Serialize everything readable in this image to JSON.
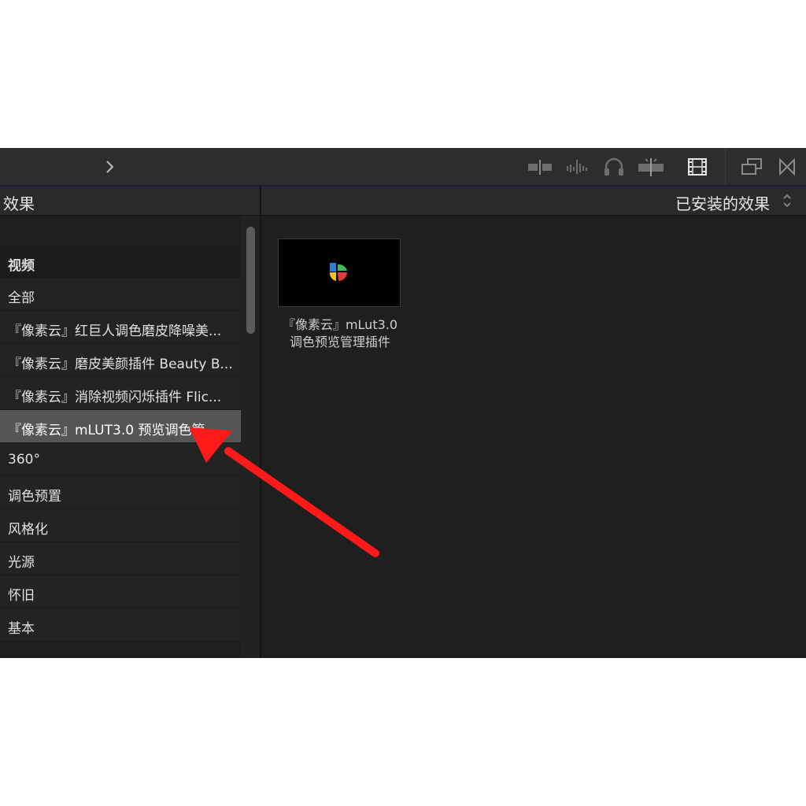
{
  "toolbar": {
    "icons": [
      "chevron-right-icon",
      "clip-split-icon",
      "audio-waveform-icon",
      "headphones-icon",
      "skimming-icon",
      "filmstrip-icon",
      "window-stack-icon",
      "transitions-icon"
    ]
  },
  "left_panel": {
    "title": "效果",
    "section": "视频",
    "items": [
      {
        "label": "全部"
      },
      {
        "label": "『像素云』红巨人调色磨皮降噪美..."
      },
      {
        "label": "『像素云』磨皮美颜插件 Beauty B..."
      },
      {
        "label": "『像素云』消除视频闪烁插件 Flic..."
      },
      {
        "label": "『像素云』mLUT3.0 预览调色管"
      },
      {
        "label": "360°"
      },
      {
        "label": "调色预置"
      },
      {
        "label": "风格化"
      },
      {
        "label": "光源"
      },
      {
        "label": "怀旧"
      },
      {
        "label": "基本"
      }
    ]
  },
  "right_panel": {
    "title": "已安装的效果",
    "effect": {
      "caption_line1": "『像素云』mLut3.0",
      "caption_line2": "调色预览管理插件"
    }
  },
  "colors": {
    "annotation_arrow": "#ff1a1a",
    "selected_row": "#555555",
    "background": "#1f1f1f"
  }
}
